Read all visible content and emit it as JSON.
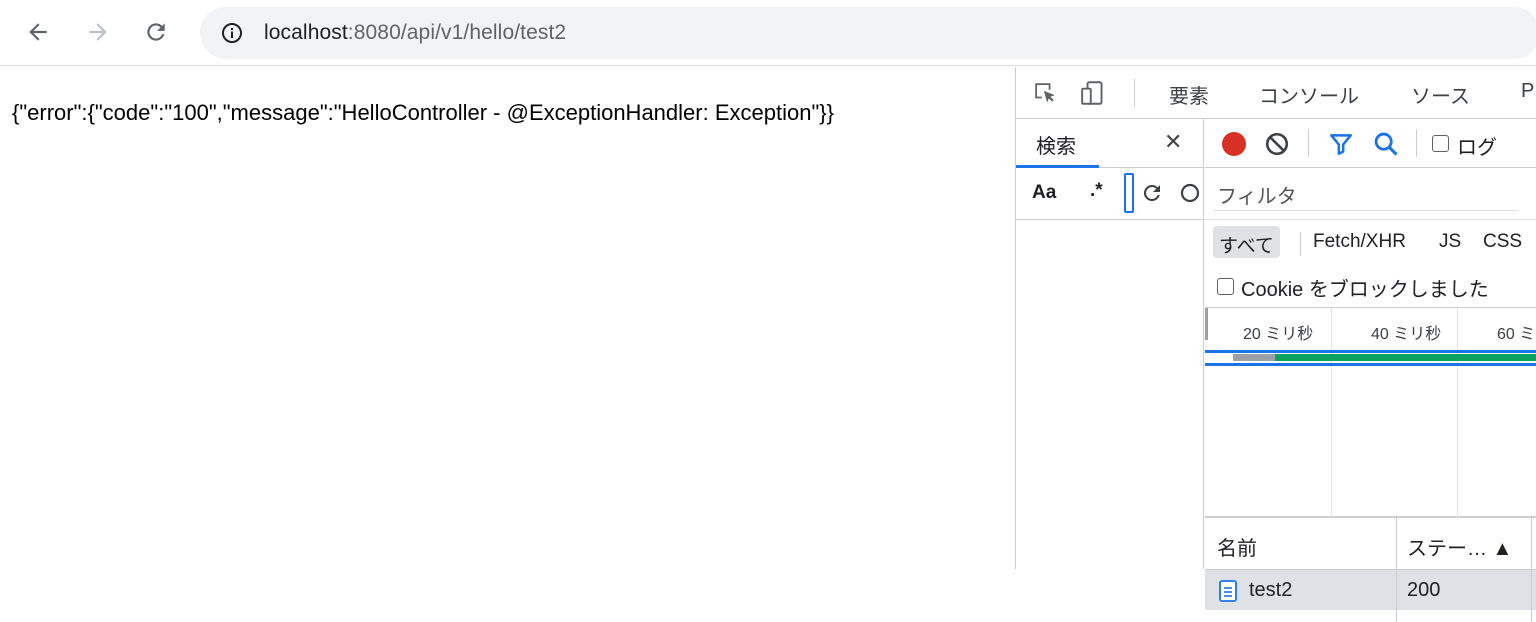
{
  "browser": {
    "back_icon": "arrow-left-icon",
    "forward_icon": "arrow-right-icon",
    "reload_icon": "reload-icon",
    "info_icon": "info-icon",
    "url_host": "localhost",
    "url_rest": ":8080/api/v1/hello/test2"
  },
  "page": {
    "body_text": "{\"error\":{\"code\":\"100\",\"message\":\"HelloController - @ExceptionHandler: Exception\"}}"
  },
  "devtools": {
    "tabs": [
      "要素",
      "コンソール",
      "ソース",
      "P"
    ],
    "search": {
      "tab_label": "検索",
      "close_label": "✕",
      "match_case_label": "Aa",
      "regex_label": ".*"
    },
    "network": {
      "preserve_log_label": "ログ",
      "filter_placeholder": "フィルタ",
      "types": [
        "すべて",
        "Fetch/XHR",
        "JS",
        "CSS"
      ],
      "blocked_cookies_label": "Cookie をブロックしました",
      "timeline_ticks": [
        "20 ミリ秒",
        "40 ミリ秒",
        "60 ミ"
      ],
      "columns": {
        "name": "名前",
        "status": "ステー… ▲"
      },
      "rows": [
        {
          "name": "test2",
          "status": "200"
        }
      ]
    },
    "colors": {
      "record": "#d93025",
      "accent": "#1a73e8",
      "waiting": "#9aa0a6",
      "download": "#0ba360"
    }
  }
}
